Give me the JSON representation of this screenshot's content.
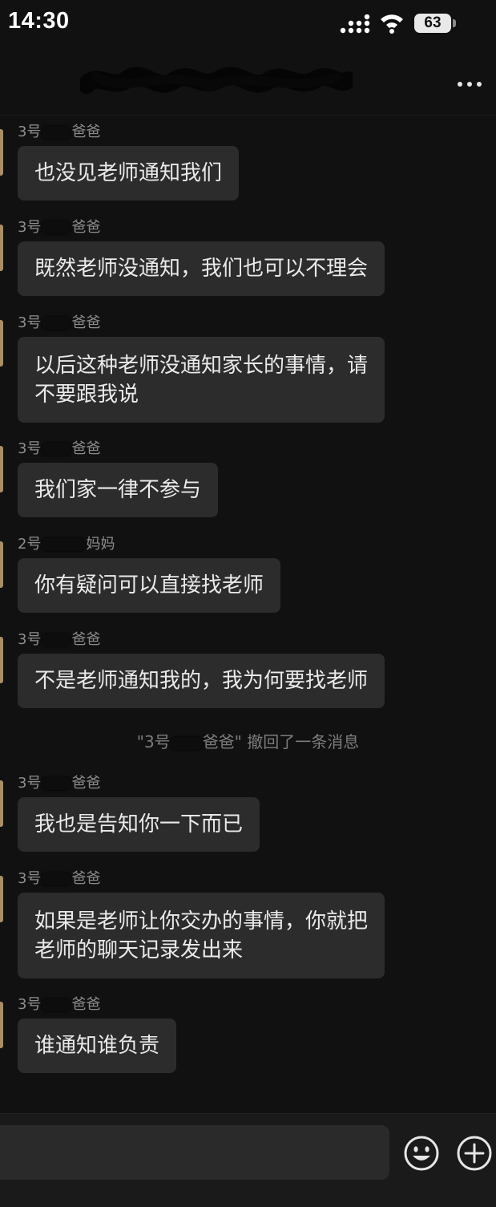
{
  "status": {
    "time": "14:30",
    "battery": "63"
  },
  "nav": {
    "title": "",
    "more_icon": "more-dots-icon"
  },
  "messages": [
    {
      "sender_prefix": "3号",
      "sender_suffix": "爸爸",
      "text": "也没见老师通知我们"
    },
    {
      "sender_prefix": "3号",
      "sender_suffix": "爸爸",
      "text": "既然老师没通知，我们也可以不理会"
    },
    {
      "sender_prefix": "3号",
      "sender_suffix": "爸爸",
      "text_line1": "以后这种老师没通知家长的事情，请",
      "text_line2": "不要跟我说"
    },
    {
      "sender_prefix": "3号",
      "sender_suffix": "爸爸",
      "text": "我们家一律不参与"
    },
    {
      "sender_prefix": "2号",
      "sender_suffix": "妈妈",
      "text": "你有疑问可以直接找老师"
    },
    {
      "sender_prefix": "3号",
      "sender_suffix": "爸爸",
      "text": "不是老师通知我的，我为何要找老师"
    },
    {
      "sender_prefix": "3号",
      "sender_suffix": "爸爸",
      "text": "我也是告知你一下而已"
    },
    {
      "sender_prefix": "3号",
      "sender_suffix": "爸爸",
      "text_line1": "如果是老师让你交办的事情，你就把",
      "text_line2": "老师的聊天记录发出来"
    },
    {
      "sender_prefix": "3号",
      "sender_suffix": "爸爸",
      "text": "谁通知谁负责"
    }
  ],
  "recall_notice": {
    "prefix": "\"3号",
    "suffix": "爸爸\" 撤回了一条消息"
  },
  "input": {
    "value": "",
    "emoji_icon": "emoji-icon",
    "plus_icon": "plus-circle-icon"
  },
  "colors": {
    "background": "#111111",
    "bubble": "#2c2c2c",
    "text": "#eaeaea",
    "sender": "#8d8d8d"
  }
}
